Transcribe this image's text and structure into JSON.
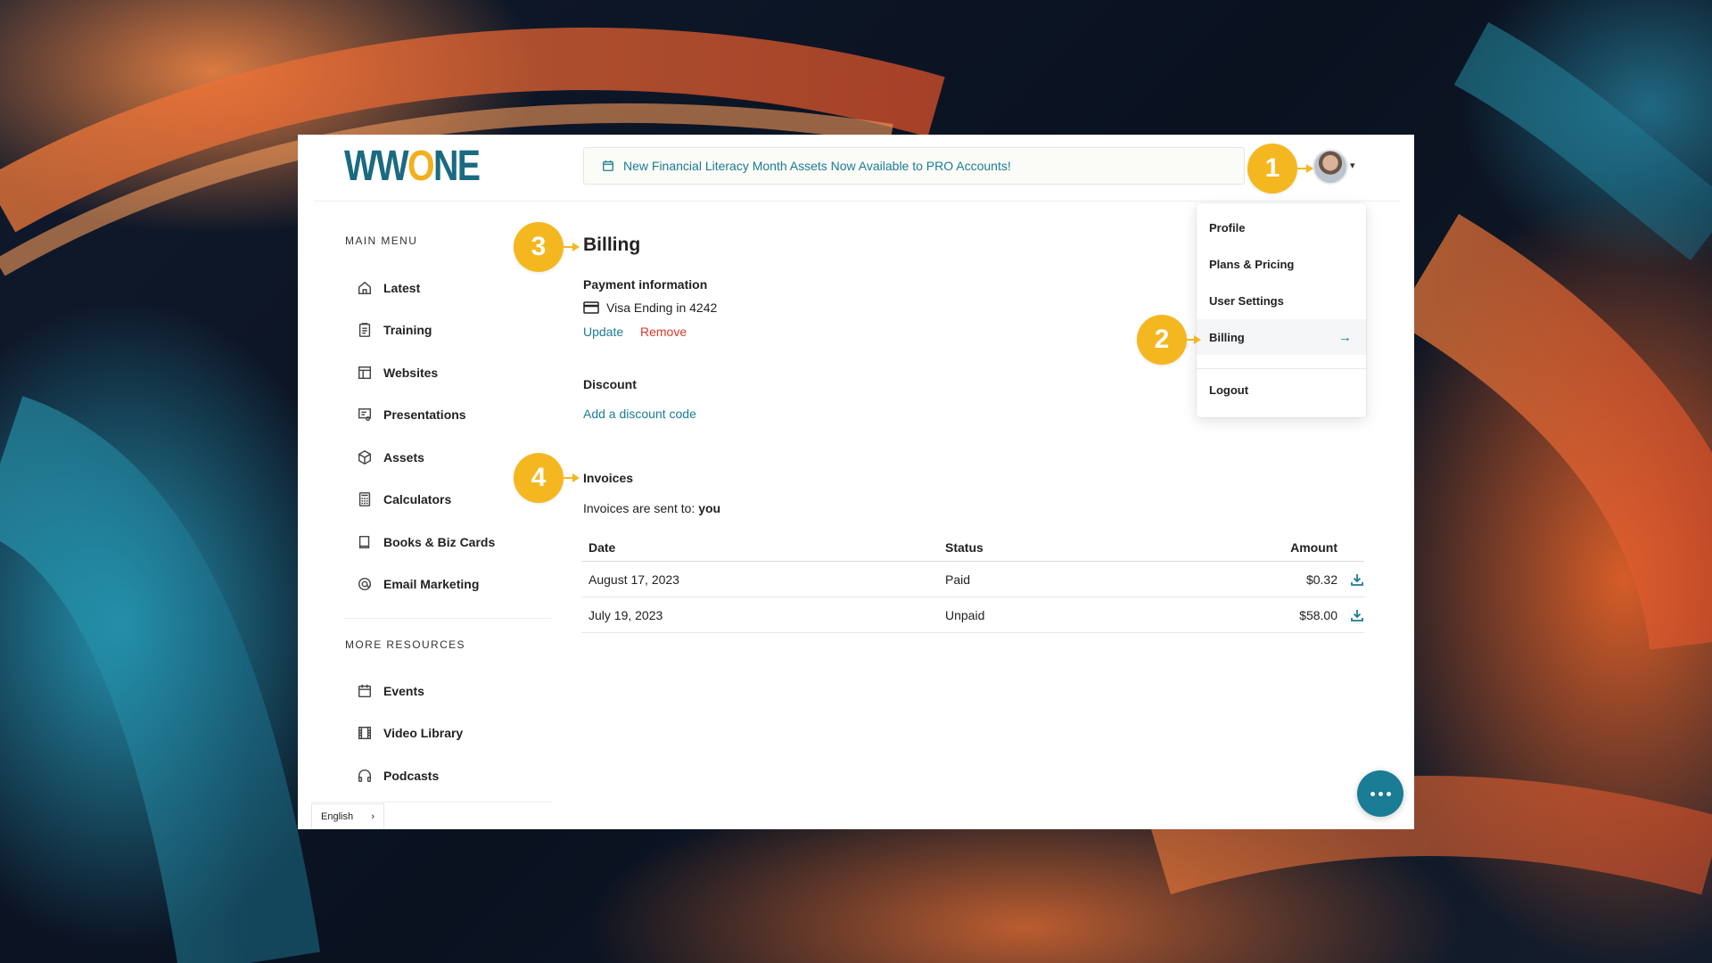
{
  "header": {
    "logo_prefix": "WW",
    "logo_o": "O",
    "logo_suffix": "NE",
    "announcement": "New Financial Literacy Month Assets Now Available to PRO Accounts!"
  },
  "sidebar": {
    "main_label": "MAIN MENU",
    "main_items": [
      {
        "label": "Latest",
        "icon": "home-icon"
      },
      {
        "label": "Training",
        "icon": "clipboard-icon"
      },
      {
        "label": "Websites",
        "icon": "layout-icon"
      },
      {
        "label": "Presentations",
        "icon": "presentation-icon"
      },
      {
        "label": "Assets",
        "icon": "box-icon"
      },
      {
        "label": "Calculators",
        "icon": "calculator-icon"
      },
      {
        "label": "Books & Biz Cards",
        "icon": "book-icon"
      },
      {
        "label": "Email Marketing",
        "icon": "at-icon"
      }
    ],
    "more_label": "MORE RESOURCES",
    "more_items": [
      {
        "label": "Events",
        "icon": "calendar-icon"
      },
      {
        "label": "Video Library",
        "icon": "film-icon"
      },
      {
        "label": "Podcasts",
        "icon": "headphones-icon"
      }
    ],
    "language": "English"
  },
  "main": {
    "title": "Billing",
    "payment_heading": "Payment information",
    "card_text": "Visa Ending in 4242",
    "update_link": "Update",
    "remove_link": "Remove",
    "discount_heading": "Discount",
    "discount_link": "Add a discount code",
    "invoices_heading": "Invoices",
    "invoices_sent_prefix": "Invoices are sent to:",
    "invoices_sent_to": "you",
    "table": {
      "headers": {
        "date": "Date",
        "status": "Status",
        "amount": "Amount"
      },
      "rows": [
        {
          "date": "August 17, 2023",
          "status": "Paid",
          "amount": "$0.32"
        },
        {
          "date": "July 19, 2023",
          "status": "Unpaid",
          "amount": "$58.00"
        }
      ]
    }
  },
  "dropdown": {
    "items": [
      "Profile",
      "Plans & Pricing",
      "User Settings",
      "Billing",
      "Logout"
    ],
    "active": "Billing"
  },
  "callouts": [
    "1",
    "2",
    "3",
    "4"
  ],
  "colors": {
    "accent": "#1a7c95",
    "callout": "#f4b71f",
    "danger": "#e0362a"
  }
}
